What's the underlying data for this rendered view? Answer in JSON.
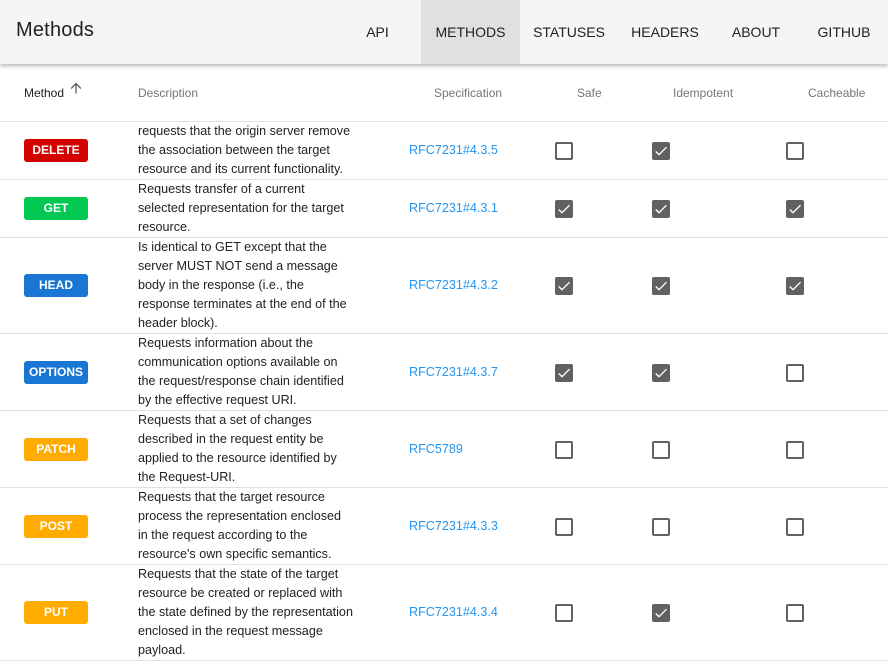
{
  "app": {
    "title": "Methods"
  },
  "nav": [
    {
      "label": "API",
      "active": false
    },
    {
      "label": "METHODS",
      "active": true
    },
    {
      "label": "STATUSES",
      "active": false
    },
    {
      "label": "HEADERS",
      "active": false
    },
    {
      "label": "ABOUT",
      "active": false
    },
    {
      "label": "GITHUB",
      "active": false
    }
  ],
  "table": {
    "columns": {
      "method": "Method",
      "description": "Description",
      "specification": "Specification",
      "safe": "Safe",
      "idempotent": "Idempotent",
      "cacheable": "Cacheable"
    },
    "sort": {
      "column": "method",
      "direction": "ascending",
      "icon": "arrow-up-icon"
    },
    "rows": [
      {
        "method": "DELETE",
        "color": "#d50000",
        "description": "requests that the origin server remove\nthe association between the target\nresource and its current functionality.",
        "spec": "RFC7231#4.3.5",
        "safe": false,
        "idempotent": true,
        "cacheable": false
      },
      {
        "method": "GET",
        "color": "#00c853",
        "description": "Requests transfer of a current\nselected representation for the target\nresource.",
        "spec": "RFC7231#4.3.1",
        "safe": true,
        "idempotent": true,
        "cacheable": true
      },
      {
        "method": "HEAD",
        "color": "#1976d2",
        "description": "Is identical to GET except that the\nserver MUST NOT send a message\nbody in the response (i.e., the\nresponse terminates at the end of the\nheader block).",
        "spec": "RFC7231#4.3.2",
        "safe": true,
        "idempotent": true,
        "cacheable": true
      },
      {
        "method": "OPTIONS",
        "color": "#1976d2",
        "description": "Requests information about the\ncommunication options available on\nthe request/response chain identified\nby the effective request URI.",
        "spec": "RFC7231#4.3.7",
        "safe": true,
        "idempotent": true,
        "cacheable": false
      },
      {
        "method": "PATCH",
        "color": "#ffab00",
        "description": "Requests that a set of changes\ndescribed in the request entity be\napplied to the resource identified by\nthe Request-URI.",
        "spec": "RFC5789",
        "safe": false,
        "idempotent": false,
        "cacheable": false
      },
      {
        "method": "POST",
        "color": "#ffab00",
        "description": "Requests that the target resource\nprocess the representation enclosed\nin the request according to the\nresource's own specific semantics.",
        "spec": "RFC7231#4.3.3",
        "safe": false,
        "idempotent": false,
        "cacheable": false
      },
      {
        "method": "PUT",
        "color": "#ffab00",
        "description": "Requests that the state of the target\nresource be created or replaced with\nthe state defined by the representation\nenclosed in the request message\npayload.",
        "spec": "RFC7231#4.3.4",
        "safe": false,
        "idempotent": true,
        "cacheable": false
      }
    ]
  }
}
